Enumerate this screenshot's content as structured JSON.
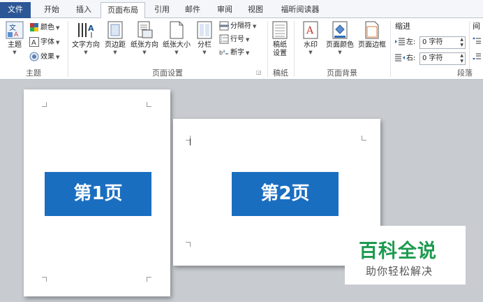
{
  "tabs": [
    "文件",
    "开始",
    "插入",
    "页面布局",
    "引用",
    "邮件",
    "审阅",
    "视图",
    "福昕阅读器"
  ],
  "groups": {
    "theme": {
      "label": "主题",
      "main_button": "主题",
      "colors": "颜色",
      "fonts": "字体",
      "effects": "效果"
    },
    "page_setup": {
      "label": "页面设置",
      "text_direction": "文字方向",
      "margins": "页边距",
      "orientation": "纸张方向",
      "size": "纸张大小",
      "columns": "分栏",
      "breaks": "分隔符",
      "line_numbers": "行号",
      "hyphenation": "断字"
    },
    "manuscript": {
      "label": "稿纸",
      "button": "稿纸设置"
    },
    "page_background": {
      "label": "页面背景",
      "watermark": "水印",
      "page_color": "页面颜色",
      "page_borders": "页面边框"
    },
    "indent": {
      "title": "缩进",
      "left_label": "左:",
      "left_value": "0 字符",
      "right_label": "右:",
      "right_value": "0 字符"
    },
    "paragraph": {
      "label": "段落",
      "spacing_title": "间"
    }
  },
  "document": {
    "page1_label": "第1页",
    "page2_label": "第2页"
  },
  "watermark": {
    "title": "百科全说",
    "subtitle": "助你轻松解决"
  },
  "colors": {
    "file_tab": "#2b5797",
    "label_box": "#1a6ec0",
    "watermark_green": "#1e9a4f"
  }
}
